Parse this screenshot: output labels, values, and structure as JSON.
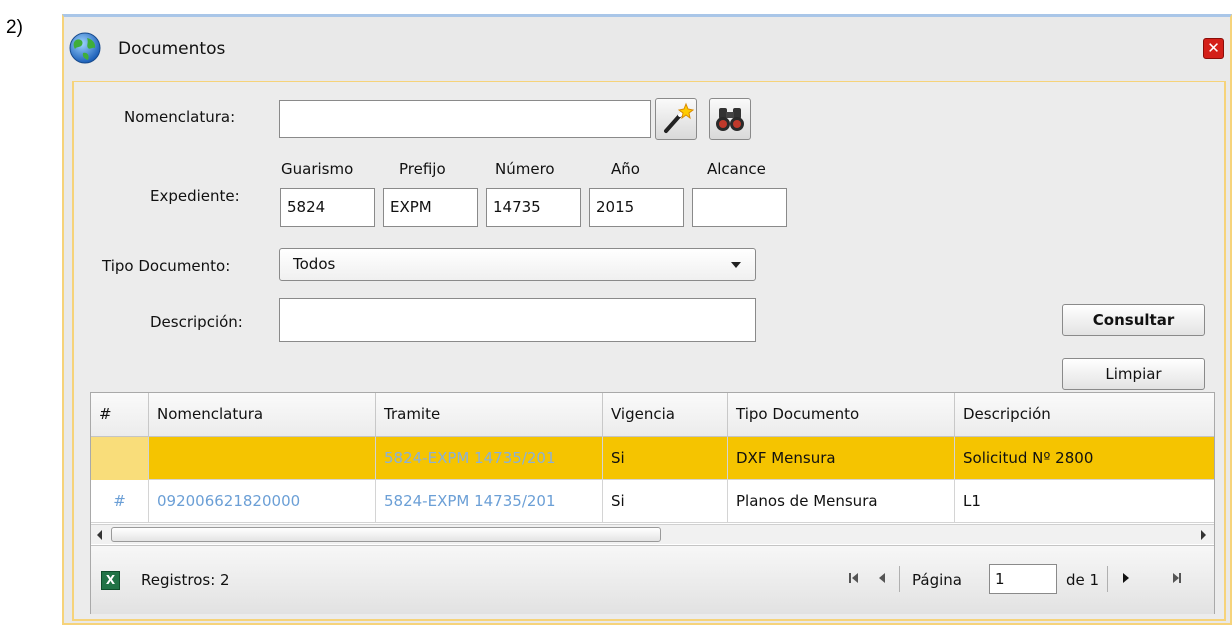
{
  "step_label": "2)",
  "window": {
    "title": "Documentos",
    "close_icon": "close-icon"
  },
  "form": {
    "nomenclatura_label": "Nomenclatura:",
    "nomenclatura_value": "",
    "expediente_label": "Expediente:",
    "columns": {
      "guarismo": "Guarismo",
      "prefijo": "Prefijo",
      "numero": "Número",
      "anio": "Año",
      "alcance": "Alcance"
    },
    "values": {
      "guarismo": "5824",
      "prefijo": "EXPM",
      "numero": "14735",
      "anio": "2015",
      "alcance": ""
    },
    "tipo_label": "Tipo Documento:",
    "tipo_value": "Todos",
    "descripcion_label": "Descripción:",
    "descripcion_value": ""
  },
  "buttons": {
    "consultar": "Consultar",
    "limpiar": "Limpiar"
  },
  "grid": {
    "headers": [
      "#",
      "Nomenclatura",
      "Tramite",
      "Vigencia",
      "Tipo Documento",
      "Descripción"
    ],
    "rows": [
      {
        "hash": "",
        "nomenclatura": "",
        "tramite": "5824-EXPM 14735/201",
        "vigencia": "Si",
        "tipo": "DXF Mensura",
        "descripcion": "Solicitud Nº 2800"
      },
      {
        "hash": "#",
        "nomenclatura": "092006621820000",
        "tramite": "5824-EXPM 14735/201",
        "vigencia": "Si",
        "tipo": "Planos de Mensura",
        "descripcion": "L1"
      }
    ]
  },
  "footer": {
    "registros": "Registros: 2",
    "pagina_label": "Página",
    "pagina_value": "1",
    "de_label": "de 1"
  },
  "colors": {
    "selected_row": "#f5c400",
    "link": "#6b9fd6",
    "border_accent": "#f6d37a"
  }
}
